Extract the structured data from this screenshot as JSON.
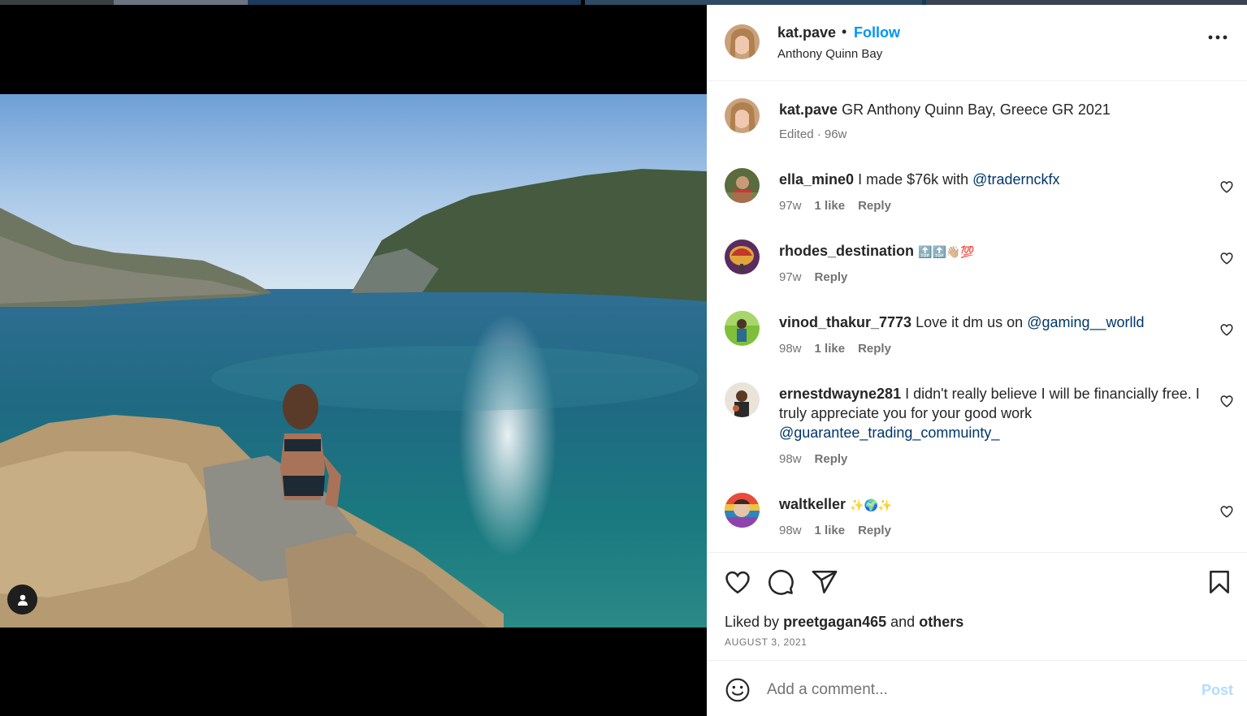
{
  "post": {
    "author": "kat.pave",
    "separator": "•",
    "follow_label": "Follow",
    "location": "Anthony Quinn Bay"
  },
  "caption": {
    "author": "kat.pave",
    "text": "GR Anthony Quinn Bay, Greece GR 2021",
    "meta": "Edited · 96w"
  },
  "comments": [
    {
      "user": "ella_mine0",
      "text": "I made $76k with",
      "mention": "@tradernckfx",
      "age": "97w",
      "likes": "1 like",
      "reply": "Reply"
    },
    {
      "user": "rhodes_destination",
      "text": "🔝🔝👋🏼💯",
      "mention": "",
      "age": "97w",
      "likes": "",
      "reply": "Reply"
    },
    {
      "user": "vinod_thakur_7773",
      "text": "Love it dm us on",
      "mention": "@gaming__worlld",
      "age": "98w",
      "likes": "1 like",
      "reply": "Reply"
    },
    {
      "user": "ernestdwayne281",
      "text": "I didn't really believe I will be financially free. I truly appreciate you for your good work",
      "mention": "@guarantee_trading_commuinty_",
      "age": "98w",
      "likes": "",
      "reply": "Reply"
    },
    {
      "user": "waltkeller",
      "text": "✨🌍✨",
      "mention": "",
      "age": "98w",
      "likes": "1 like",
      "reply": "Reply"
    }
  ],
  "likes": {
    "prefix": "Liked by",
    "user": "preetgagan465",
    "joiner": "and",
    "others": "others"
  },
  "date": "AUGUST 3, 2021",
  "composer": {
    "placeholder": "Add a comment...",
    "post_label": "Post"
  },
  "icons": {
    "more": "more-horizontal-icon",
    "heart": "heart-icon",
    "comment": "comment-icon",
    "share": "paper-plane-icon",
    "save": "bookmark-icon",
    "emoji": "smiley-icon",
    "tagged_user": "user-tag-icon"
  },
  "colors": {
    "follow": "#0095f6",
    "mention": "#00376b",
    "muted": "#737373",
    "post_disabled": "#b3dbff"
  }
}
